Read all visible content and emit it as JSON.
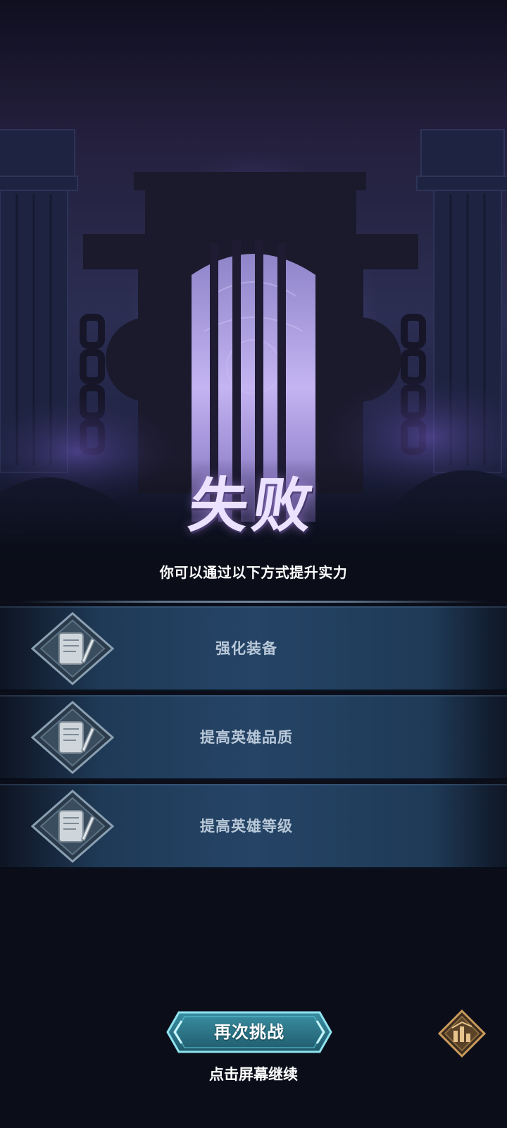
{
  "result": {
    "title": "失败",
    "subtitle": "你可以通过以下方式提升实力"
  },
  "options": [
    {
      "label": "强化装备",
      "icon": "scroll-quill-icon"
    },
    {
      "label": "提高英雄品质",
      "icon": "scroll-quill-icon"
    },
    {
      "label": "提高英雄等级",
      "icon": "scroll-quill-icon"
    }
  ],
  "actions": {
    "retry_label": "再次挑战",
    "continue_hint": "点击屏幕继续",
    "stats_icon": "bar-chart-icon"
  },
  "colors": {
    "background": "#0a0d17",
    "gate_glow": "#b9a6e6",
    "option_bar": "#254466",
    "retry_button": "#3fa6b8",
    "stats_button": "#a07a4a"
  }
}
